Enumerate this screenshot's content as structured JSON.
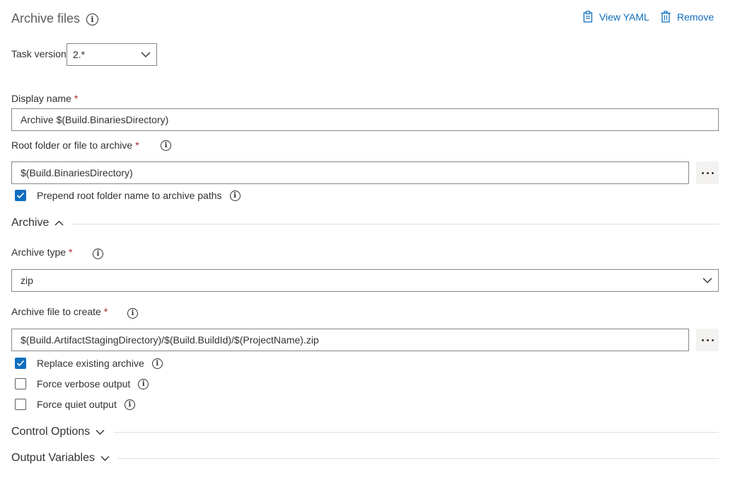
{
  "header": {
    "title": "Archive files",
    "view_yaml": "View YAML",
    "remove": "Remove"
  },
  "task_version": {
    "label": "Task version",
    "value": "2.*"
  },
  "display_name": {
    "label": "Display name",
    "required": "*",
    "value": "Archive $(Build.BinariesDirectory)"
  },
  "root_folder": {
    "label": "Root folder or file to archive",
    "required": "*",
    "value": "$(Build.BinariesDirectory)",
    "more": "..."
  },
  "prepend_root": {
    "label": "Prepend root folder name to archive paths",
    "checked": true
  },
  "archive_section": {
    "label": "Archive",
    "expanded": true
  },
  "archive_type": {
    "label": "Archive type",
    "required": "*",
    "value": "zip"
  },
  "archive_file": {
    "label": "Archive file to create",
    "required": "*",
    "value": "$(Build.ArtifactStagingDirectory)/$(Build.BuildId)/$(ProjectName).zip"
  },
  "options": [
    {
      "label": "Replace existing archive",
      "checked": true
    },
    {
      "label": "Force verbose output",
      "checked": false
    },
    {
      "label": "Force quiet output",
      "checked": false
    }
  ],
  "control_options": {
    "label": "Control Options",
    "expanded": false
  },
  "output_variables": {
    "label": "Output Variables",
    "expanded": false
  },
  "colors": {
    "accent": "#106ebe",
    "required": "#a4262c",
    "border": "#8a8886",
    "divider": "#e1dfdd"
  }
}
